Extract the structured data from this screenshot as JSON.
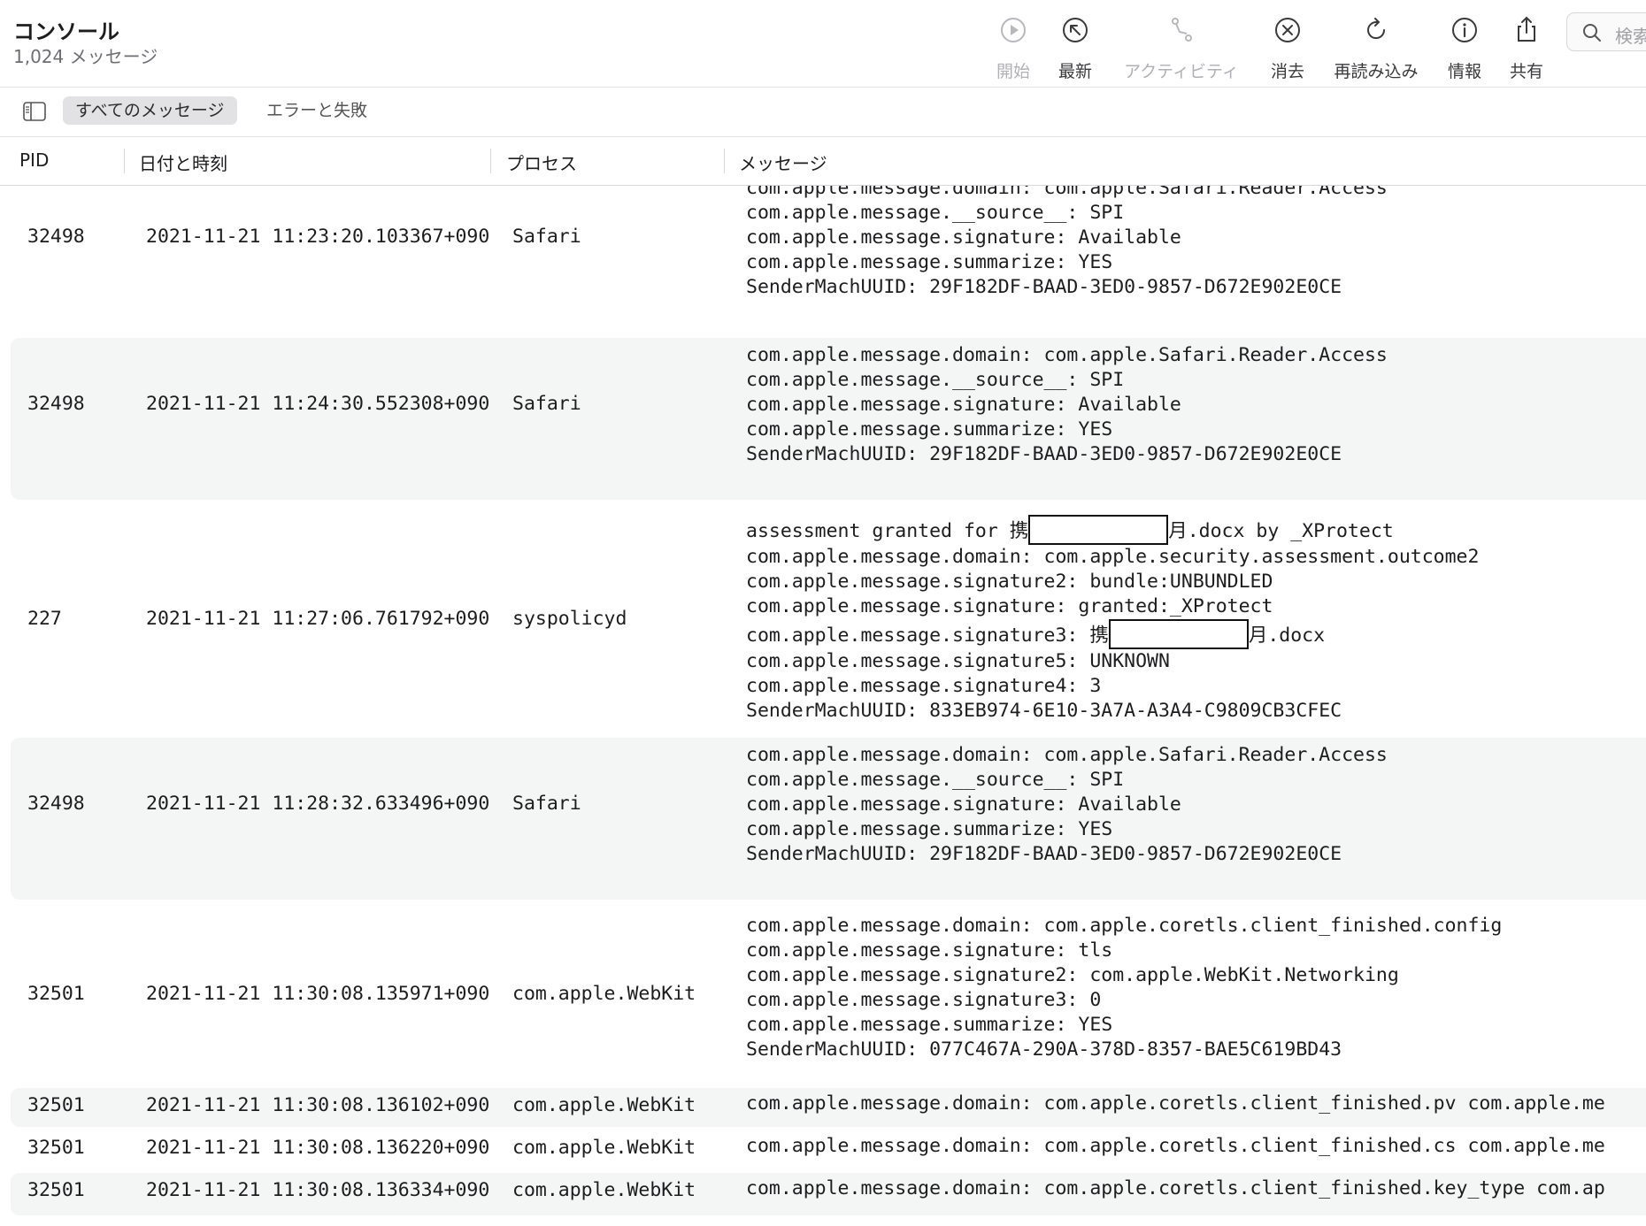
{
  "app": {
    "title": "コンソール",
    "subtitle": "1,024 メッセージ"
  },
  "toolbar": {
    "start": "開始",
    "latest": "最新",
    "activity": "アクティビティ",
    "clear": "消去",
    "reload": "再読み込み",
    "info": "情報",
    "share": "共有",
    "search_placeholder": "検索"
  },
  "filters": {
    "all": "すべてのメッセージ",
    "errors": "エラーと失敗"
  },
  "columns": {
    "pid": "PID",
    "date": "日付と時刻",
    "process": "プロセス",
    "message": "メッセージ"
  },
  "rows": [
    {
      "pid": "32498",
      "date": "2021-11-21 11:23:20.103367+0900",
      "process": "Safari",
      "lines": [
        "com.apple.message.domain: com.apple.Safari.Reader.Access",
        "com.apple.message.__source__: SPI",
        "com.apple.message.signature: Available",
        "com.apple.message.summarize: YES",
        "SenderMachUUID: 29F182DF-BAAD-3ED0-9857-D672E902E0CE"
      ]
    },
    {
      "pid": "32498",
      "date": "2021-11-21 11:24:30.552308+0900",
      "process": "Safari",
      "lines": [
        "com.apple.message.domain: com.apple.Safari.Reader.Access",
        "com.apple.message.__source__: SPI",
        "com.apple.message.signature: Available",
        "com.apple.message.summarize: YES",
        "SenderMachUUID: 29F182DF-BAAD-3ED0-9857-D672E902E0CE"
      ]
    },
    {
      "pid": "227",
      "date": "2021-11-21 11:27:06.761792+0900",
      "process": "syspolicyd",
      "line0_pre": "assessment granted for 携",
      "line0_post": "月.docx by _XProtect",
      "line1": "com.apple.message.domain: com.apple.security.assessment.outcome2",
      "line2": "com.apple.message.signature2: bundle:UNBUNDLED",
      "line3": "com.apple.message.signature: granted:_XProtect",
      "line4_pre": "com.apple.message.signature3: 携",
      "line4_post": "月.docx",
      "line5": "com.apple.message.signature5: UNKNOWN",
      "line6": "com.apple.message.signature4: 3",
      "line7": "SenderMachUUID: 833EB974-6E10-3A7A-A3A4-C9809CB3CFEC"
    },
    {
      "pid": "32498",
      "date": "2021-11-21 11:28:32.633496+0900",
      "process": "Safari",
      "lines": [
        "com.apple.message.domain: com.apple.Safari.Reader.Access",
        "com.apple.message.__source__: SPI",
        "com.apple.message.signature: Available",
        "com.apple.message.summarize: YES",
        "SenderMachUUID: 29F182DF-BAAD-3ED0-9857-D672E902E0CE"
      ]
    },
    {
      "pid": "32501",
      "date": "2021-11-21 11:30:08.135971+0900",
      "process": "com.apple.WebKit",
      "lines": [
        "com.apple.message.domain: com.apple.coretls.client_finished.config",
        "com.apple.message.signature: tls",
        "com.apple.message.signature2: com.apple.WebKit.Networking",
        "com.apple.message.signature3: 0",
        "com.apple.message.summarize: YES",
        "SenderMachUUID: 077C467A-290A-378D-8357-BAE5C619BD43"
      ]
    },
    {
      "pid": "32501",
      "date": "2021-11-21 11:30:08.136102+0900",
      "process": "com.apple.WebKit",
      "lines": [
        "com.apple.message.domain: com.apple.coretls.client_finished.pv com.apple.me"
      ]
    },
    {
      "pid": "32501",
      "date": "2021-11-21 11:30:08.136220+0900",
      "process": "com.apple.WebKit",
      "lines": [
        "com.apple.message.domain: com.apple.coretls.client_finished.cs com.apple.me"
      ]
    },
    {
      "pid": "32501",
      "date": "2021-11-21 11:30:08.136334+0900",
      "process": "com.apple.WebKit",
      "lines": [
        "com.apple.message.domain: com.apple.coretls.client_finished.key_type com.ap"
      ]
    }
  ]
}
